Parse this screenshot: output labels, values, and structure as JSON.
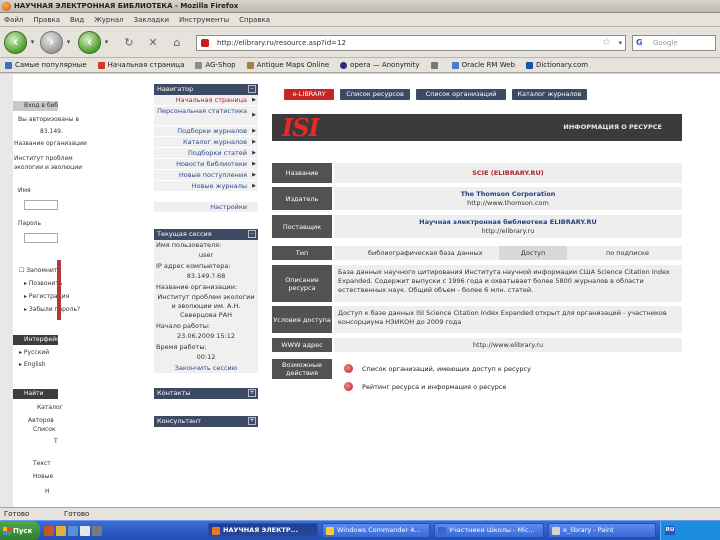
{
  "window": {
    "title": "НАУЧНАЯ ЭЛЕКТРОННАЯ БИБЛИОТЕКА - Mozilla Firefox"
  },
  "menu": [
    "Файл",
    "Правка",
    "Вид",
    "Журнал",
    "Закладки",
    "Инструменты",
    "Справка"
  ],
  "browser": {
    "url": "http://elibrary.ru/resource.asp?id=12",
    "search_placeholder": "Google"
  },
  "bookmarks": [
    "Самые популярные",
    "Начальная страница",
    "AG-Shop",
    "Antique Maps Online",
    "opera — Anonymity",
    "",
    "Oracle RM Web",
    "Dictionary.com"
  ],
  "left_panel": {
    "login_header": "Вход в библиотеку",
    "auth_text": "Вы авторизованы в",
    "ip": "83.149.",
    "org_label": "Название организации",
    "org_lines": [
      "Институт проблем",
      "экологии и эволюции"
    ],
    "login_label": "Имя",
    "password_label": "Пароль",
    "remember": "Запомнить",
    "links": [
      "Позвонить",
      "Регистрация",
      "Забыли пароль?"
    ],
    "lang_header": "Интерфейс",
    "langs": [
      "Русский",
      "English"
    ],
    "search_header": "Найти",
    "search_lines": [
      "Каталог",
      "Авторов",
      "Список",
      "Т",
      "Текст",
      "Новые",
      "Н"
    ]
  },
  "nav": {
    "header": "Навигатор",
    "items": [
      {
        "label": "Начальная страница",
        "red": true
      },
      {
        "label": "Персональная статистика",
        "tall": true
      },
      {
        "label": "Подборки журналов"
      },
      {
        "label": "Каталог журналов"
      },
      {
        "label": "Подборки статей"
      },
      {
        "label": "Новости библиотеки"
      },
      {
        "label": "Новые поступления"
      },
      {
        "label": "Новые журналы"
      },
      {
        "label": "Настройки"
      }
    ],
    "session_header": "Текущая сессия",
    "session_lines": [
      "Имя пользователя:",
      "user",
      "IP адрес компьютера:",
      "83.149.?.68",
      "Название организации:",
      "Институт проблем экологии",
      "и эволюции им. А.Н.",
      "Северцова РАН",
      "Начало работы:",
      "23.06.2009 15:12",
      "Время работы:",
      "00:12",
      "Закончить сессию"
    ],
    "contacts_header": "Контакты",
    "consult_header": "Консультант"
  },
  "tabs": [
    "e-LIBRARY",
    "Список ресурсов",
    "Список организаций",
    "Каталог журналов"
  ],
  "resource": {
    "logo": "ISI",
    "title": "ИНФОРМАЦИЯ О РЕСУРСЕ",
    "name_label": "Название",
    "name_value": "SCIE (ELIBRARY.RU)",
    "publisher_label": "Издатель",
    "publisher_value": "The Thomson Corporation",
    "publisher_url": "http://www.thomson.com",
    "provider_label": "Поставщик",
    "provider_value": "Научная электронная библиотека ELIBRARY.RU",
    "provider_url": "http://elibrary.ru",
    "type_label": "Тип",
    "type_value": "библиографическая база данных",
    "access_label": "Доступ",
    "access_value": "по подписке",
    "desc_label": "Описание ресурса",
    "desc_value": "База данных научного цитирования Института научной информации США Science Citation Index Expanded. Содержит выпуски с 1996 года и охватывает более 5800 журналов в области естественных наук. Общий объем - более 6 млн. статей.",
    "cond_label": "Условия доступа",
    "cond_value": "Доступ к базе данных ISI Science Citation Index Expanded открыт для организаций - участников консорциума НЭИКОН до 2009 года",
    "www_label": "WWW адрес",
    "www_value": "http://www.elibrary.ru",
    "actions_label": "Возможные действия",
    "actions": [
      "Список организаций, имеющих доступ к ресурсу",
      "Рейтинг ресурса и информация о ресурсе"
    ]
  },
  "status": {
    "left": "Готово",
    "right": "Готово"
  },
  "taskbar": {
    "start": "Пуск",
    "buttons": [
      "НАУЧНАЯ ЭЛЕКТР...",
      "Windows Commander 4...",
      "Участники Школы - Mic...",
      "e_library - Paint"
    ],
    "lang": "RU"
  },
  "colors": {
    "accent_red": "#c52525",
    "nav_dark": "#3d4a63",
    "label_gray": "#525252"
  }
}
